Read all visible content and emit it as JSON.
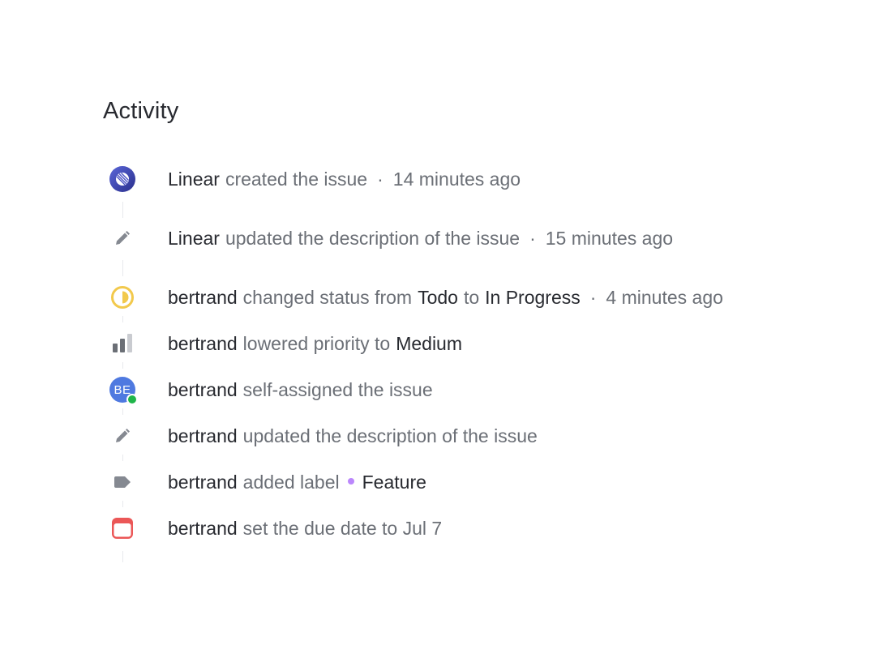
{
  "panel": {
    "title": "Activity"
  },
  "colors": {
    "status_in_progress": "#f2c94c",
    "label_feature": "#bb87fc",
    "due_date": "#eb5757",
    "avatar_bg": "#4f79e0",
    "presence": "#1fb54a"
  },
  "activity": [
    {
      "icon": "linear-logo-icon",
      "actor": "Linear",
      "action": "created the issue",
      "time": "14 minutes ago"
    },
    {
      "icon": "pencil-icon",
      "actor": "Linear",
      "action": "updated the description of the issue",
      "time": "15 minutes ago"
    },
    {
      "icon": "in-progress-status-icon",
      "actor": "bertrand",
      "action": "changed status from",
      "from_value": "Todo",
      "to_word": "to",
      "to_value": "In Progress",
      "time": "4 minutes ago"
    },
    {
      "icon": "priority-medium-icon",
      "actor": "bertrand",
      "action": "lowered priority to",
      "value": "Medium"
    },
    {
      "icon": "avatar",
      "avatar_initials": "BE",
      "actor": "bertrand",
      "action": "self-assigned the issue"
    },
    {
      "icon": "pencil-icon",
      "actor": "bertrand",
      "action": "updated the description of the issue"
    },
    {
      "icon": "label-tag-icon",
      "actor": "bertrand",
      "action": "added label",
      "value": "Feature"
    },
    {
      "icon": "calendar-icon",
      "actor": "bertrand",
      "action": "set the due date to Jul 7"
    }
  ],
  "separator": "·"
}
